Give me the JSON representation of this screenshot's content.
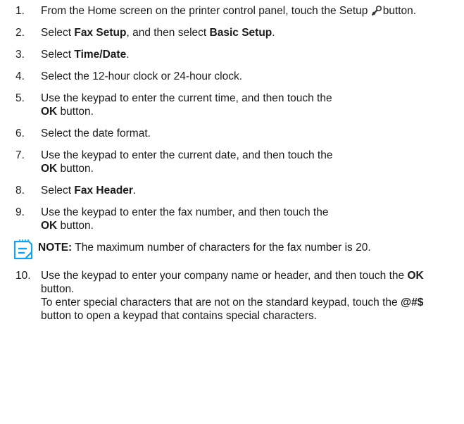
{
  "steps": [
    {
      "num": "1.",
      "parts": [
        [
          "From the Home screen on the printer control panel, touch the Setup ",
          false
        ],
        [
          "ICON",
          false
        ],
        [
          "button.",
          false
        ]
      ]
    },
    {
      "num": "2.",
      "parts": [
        [
          "Select ",
          false
        ],
        [
          "Fax Setup",
          true
        ],
        [
          ", and then select ",
          false
        ],
        [
          "Basic Setup",
          true
        ],
        [
          ".",
          false
        ]
      ]
    },
    {
      "num": "3.",
      "parts": [
        [
          "Select ",
          false
        ],
        [
          "Time/Date",
          true
        ],
        [
          ".",
          false
        ]
      ]
    },
    {
      "num": "4.",
      "parts": [
        [
          "Select the 12-hour clock or 24-hour clock.",
          false
        ]
      ]
    },
    {
      "num": "5.",
      "parts": [
        [
          "Use the keypad to enter the current time, and then touch the ",
          false
        ],
        [
          "BR",
          false
        ],
        [
          "OK",
          true
        ],
        [
          " button.",
          false
        ]
      ]
    },
    {
      "num": "6.",
      "parts": [
        [
          "Select the date format.",
          false
        ]
      ]
    },
    {
      "num": "7.",
      "parts": [
        [
          "Use the keypad to enter the current date, and then touch the ",
          false
        ],
        [
          "BR",
          false
        ],
        [
          "OK",
          true
        ],
        [
          " button.",
          false
        ]
      ]
    },
    {
      "num": "8.",
      "parts": [
        [
          "Select ",
          false
        ],
        [
          "Fax Header",
          true
        ],
        [
          ".",
          false
        ]
      ]
    },
    {
      "num": "9.",
      "parts": [
        [
          "Use the keypad to enter the fax number, and then touch the ",
          false
        ],
        [
          "BR",
          false
        ],
        [
          "OK",
          true
        ],
        [
          " button.",
          false
        ]
      ]
    }
  ],
  "note": {
    "label": "NOTE:",
    "text": " The maximum number of characters for the fax number is 20."
  },
  "step10": {
    "num": "10.",
    "line1_pre": "Use the keypad to enter your company name or header, and then touch the ",
    "line1_bold": "OK",
    "line1_post": " button.",
    "line2_pre": "To enter special characters that are not on the standard keypad, touch the ",
    "line2_bold": "@#$",
    "line2_post": " button to open a keypad that contains special characters."
  },
  "colors": {
    "text": "#1a1a1a",
    "note_icon": "#1ba1e2"
  },
  "icons": {
    "setup": "wrench-icon",
    "note": "note-icon"
  }
}
